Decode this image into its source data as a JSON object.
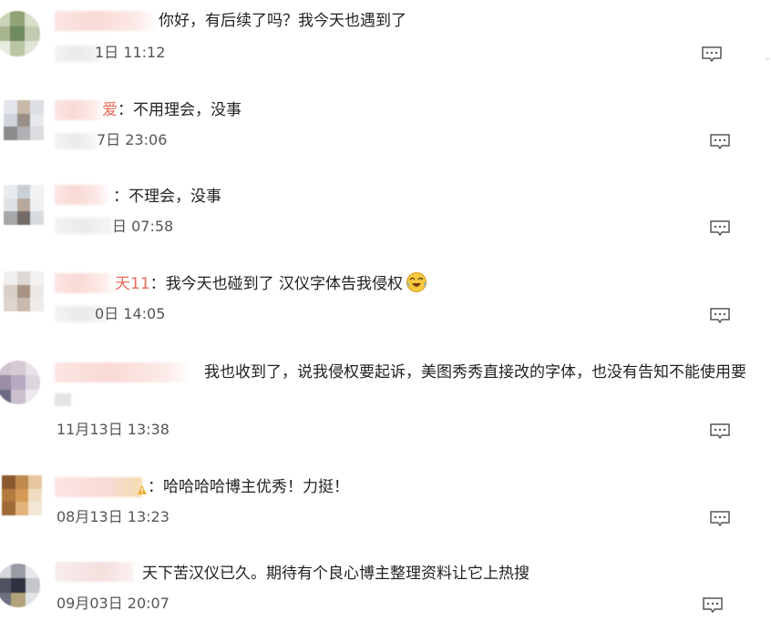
{
  "comments": [
    {
      "name_tail": "",
      "separator": "",
      "text": "你好，有后续了吗？我今天也遇到了",
      "date": "1日 11:12",
      "reply_icon": "reply-comment-icon",
      "avatar_colors": [
        "#c9d3b5",
        "#8fa374",
        "#d7dec9",
        "#a7b58f",
        "#6f8a5c",
        "#c2cbb1",
        "#e8ece1",
        "#b9c5a3",
        "#dfe4d6"
      ]
    },
    {
      "name_tail": "爱",
      "separator": "：",
      "text": "不用理会，没事",
      "date": "7日 23:06",
      "reply_icon": "reply-comment-icon",
      "avatar_colors": [
        "#e3e6ea",
        "#c7b8a8",
        "#dcdfe3",
        "#cfd5db",
        "#9a8f88",
        "#e7e8ea",
        "#8c8c8e",
        "#b1b2b5",
        "#dadcdf"
      ]
    },
    {
      "name_tail": "",
      "separator": "：",
      "text": "不理会，没事",
      "date": "日 07:58",
      "reply_icon": "reply-comment-icon",
      "avatar_colors": [
        "#e8ecef",
        "#c9d0d5",
        "#f0f2f3",
        "#dfe3e6",
        "#b7a89e",
        "#eef0f1",
        "#a6a7a9",
        "#736b68",
        "#d9dcde"
      ]
    },
    {
      "name_tail": "天11",
      "separator": "：",
      "text": "我今天也碰到了 汉仪字体告我侵权",
      "date": "0日 14:05",
      "reply_icon": "reply-comment-icon",
      "avatar_colors": [
        "#f1efee",
        "#e0d8d2",
        "#f4f2f1",
        "#d8d0c8",
        "#a79384",
        "#ece8e5",
        "#ddd4cd",
        "#c9b9ad",
        "#efebe8"
      ]
    },
    {
      "name_tail": "",
      "separator": "",
      "text": "我也收到了，说我侵权要起诉，美图秀秀直接改的字体，也没有告知不能使用要",
      "date": "11月13日 13:38",
      "reply_icon": "reply-comment-icon",
      "avatar_colors": [
        "#cfc4cf",
        "#d7cbd3",
        "#e9e2e8",
        "#9a8fa6",
        "#b7a9bf",
        "#dcd5de",
        "#6f6a86",
        "#c9c0cc",
        "#ece8ee"
      ]
    },
    {
      "name_tail": "",
      "separator": "：",
      "text": "哈哈哈哈博主优秀！力挺！",
      "date": "08月13日 13:23",
      "reply_icon": "reply-comment-icon",
      "avatar_colors": [
        "#8a5a2e",
        "#c08a4e",
        "#e7c7a0",
        "#b47a3f",
        "#d49a55",
        "#f0dcc2",
        "#a06a38",
        "#e2b37a",
        "#f3e6d4"
      ]
    },
    {
      "name_tail": "",
      "separator": "",
      "text": "天下苦汉仪已久。期待有个良心博主整理资料让它上热搜",
      "date": "09月03日 20:07",
      "reply_icon": "reply-comment-icon",
      "avatar_colors": [
        "#d6d7db",
        "#9a9ca4",
        "#e6e7ea",
        "#4f5360",
        "#2e3140",
        "#c4c6cc",
        "#6d7080",
        "#b0a27a",
        "#e2e3e6"
      ]
    }
  ]
}
